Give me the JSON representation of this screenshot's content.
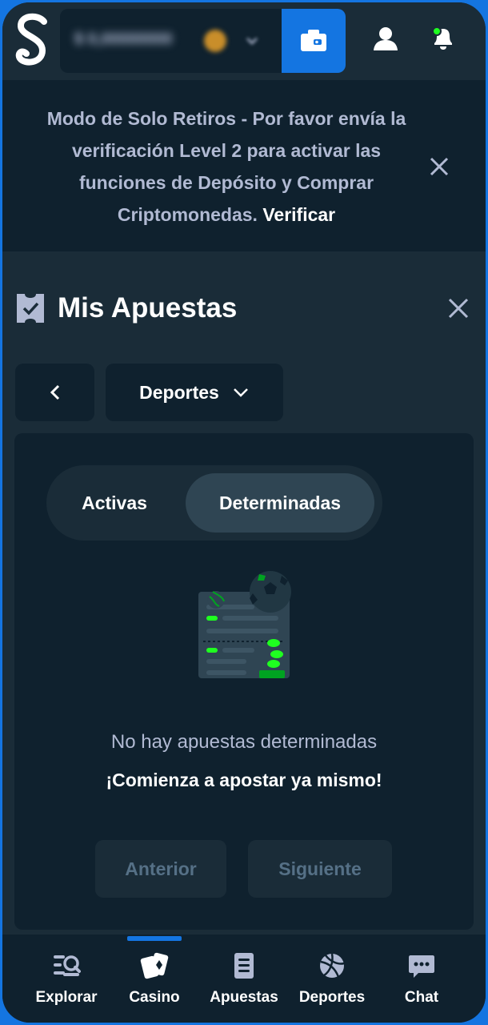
{
  "header": {
    "balance_amount": "$ 0,00000000",
    "icons": [
      "stake-logo-icon",
      "coin-icon",
      "chevron-down-icon",
      "wallet-icon",
      "user-icon",
      "bell-icon"
    ],
    "notification_dot_color": "#1fff20",
    "wallet_color": "#1475e1"
  },
  "banner": {
    "message": "Modo de Solo Retiros - Por favor envía la verificación Level 2 para activar las funciones de Depósito y Comprar Criptomonedas.",
    "link": "Verificar"
  },
  "page": {
    "title": "Mis Apuestas"
  },
  "filter": {
    "selected": "Deportes"
  },
  "tabs": [
    {
      "label": "Activas",
      "active": false
    },
    {
      "label": "Determinadas",
      "active": true
    }
  ],
  "empty_state": {
    "message": "No hay apuestas determinadas",
    "cta": "¡Comienza a apostar ya mismo!"
  },
  "pagination": {
    "prev": "Anterior",
    "next": "Siguiente"
  },
  "bottom_nav": {
    "active": "Casino",
    "items": [
      {
        "label": "Explorar",
        "icon": "explore-icon"
      },
      {
        "label": "Casino",
        "icon": "casino-cards-icon"
      },
      {
        "label": "Apuestas",
        "icon": "betslip-icon"
      },
      {
        "label": "Deportes",
        "icon": "sports-ball-icon"
      },
      {
        "label": "Chat",
        "icon": "chat-icon"
      }
    ]
  }
}
